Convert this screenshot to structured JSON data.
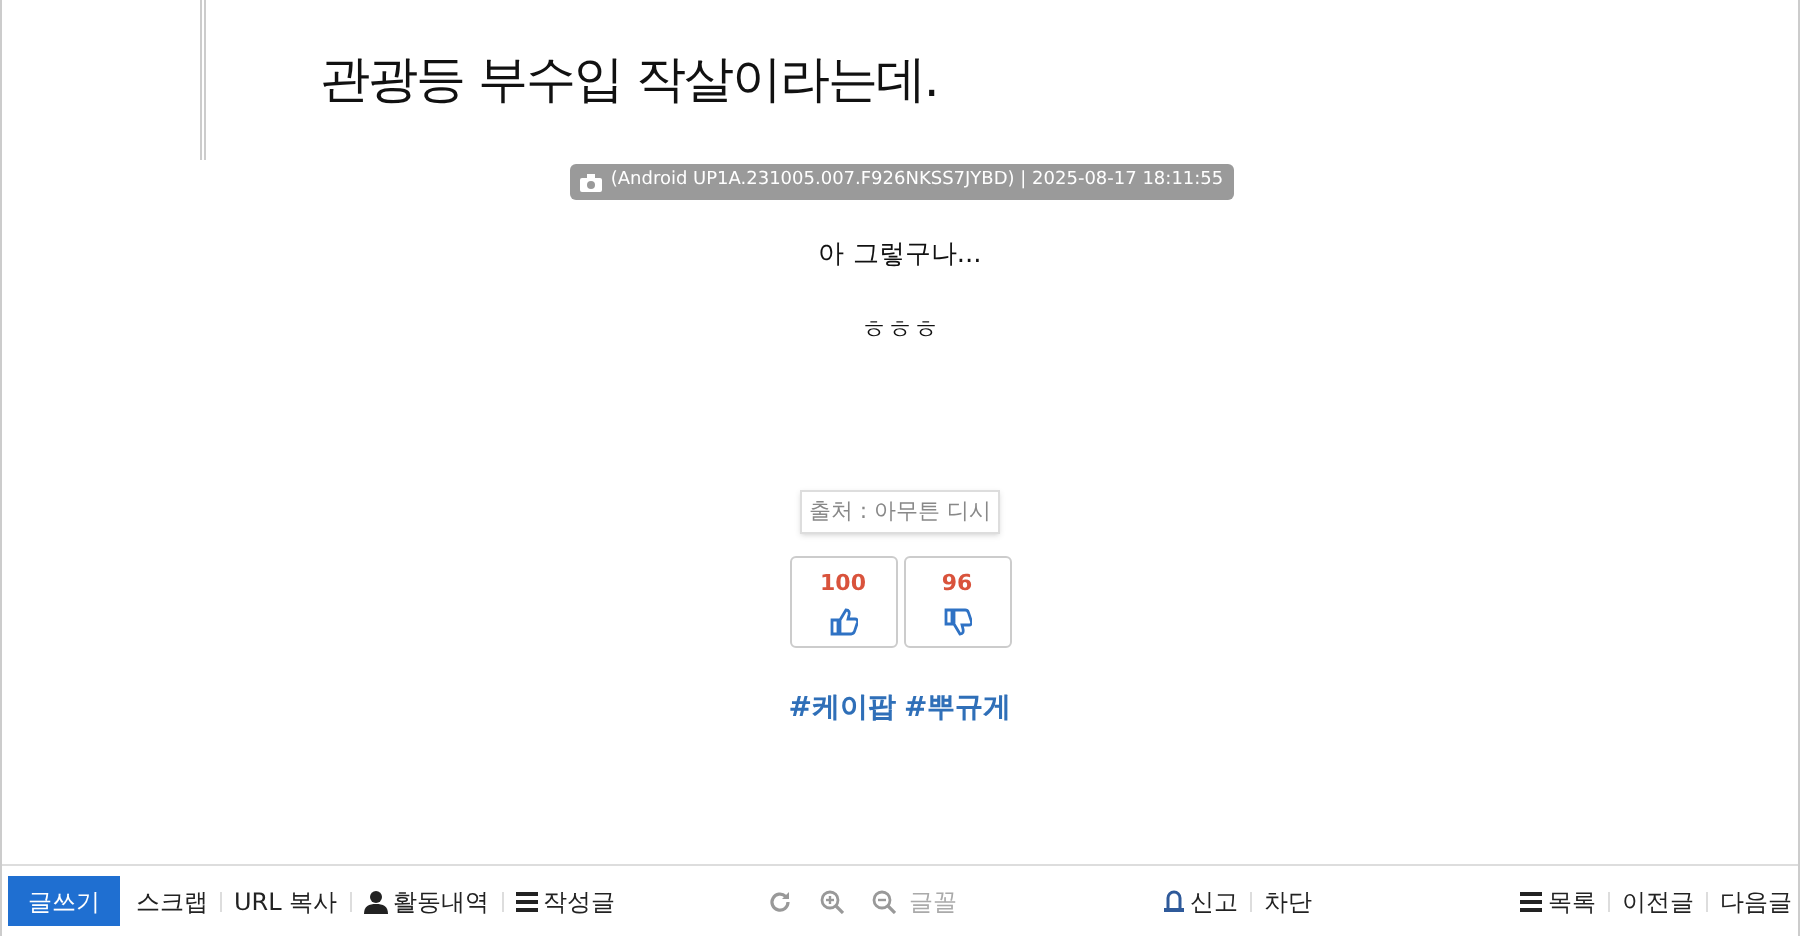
{
  "quote": {
    "text": "관광등 부수입 작살이라는데."
  },
  "photo_caption": "(Android UP1A.231005.007.F926NKSS7JYBD) | 2025-08-17 18:11:55",
  "paragraphs": [
    "아 그렇구나...",
    "ㅎㅎㅎ"
  ],
  "source": "출처 : 아무튼 디시",
  "votes": [
    {
      "kind": "up",
      "count": "100"
    },
    {
      "kind": "down",
      "count": "96"
    }
  ],
  "tags": [
    "#케이팝",
    "#뿌규게"
  ],
  "bottom_bar": {
    "left": [
      {
        "kind": "primary",
        "label": "글쓰기"
      },
      {
        "kind": "plain",
        "label": "스크랩"
      },
      {
        "kind": "plain",
        "label": "URL 복사"
      },
      {
        "kind": "user",
        "label": "활동내역"
      },
      {
        "kind": "list",
        "label": "작성글"
      }
    ],
    "tools": [
      {
        "kind": "refresh"
      },
      {
        "kind": "zoom-in"
      },
      {
        "kind": "zoom-out",
        "label": "글꼴"
      }
    ],
    "center": [
      {
        "kind": "report",
        "label": "신고"
      },
      {
        "kind": "plain",
        "label": "차단"
      }
    ],
    "right": [
      {
        "kind": "list",
        "label": "목록"
      },
      {
        "kind": "plain",
        "label": "이전글"
      },
      {
        "kind": "plain",
        "label": "다음글"
      }
    ]
  }
}
